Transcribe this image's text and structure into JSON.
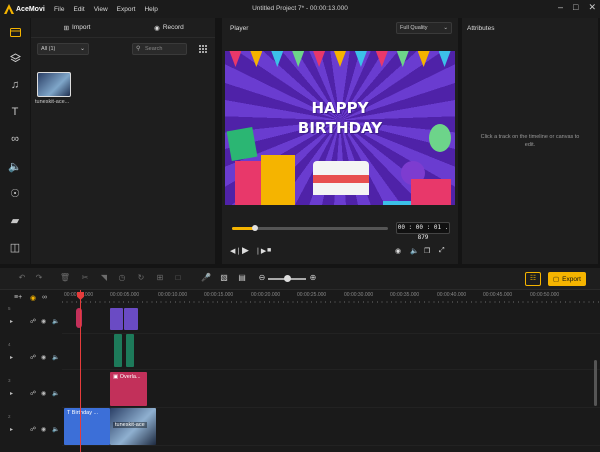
{
  "app": {
    "name": "AceMovi",
    "window_title": "Untitled Project 7* - 00:00:13.000",
    "menu": [
      "File",
      "Edit",
      "View",
      "Export",
      "Help"
    ]
  },
  "rail": [
    "media-folder",
    "layers",
    "music",
    "text",
    "effects",
    "transitions",
    "filters",
    "stickers",
    "split-screen"
  ],
  "media": {
    "import_label": "Import",
    "record_label": "Record",
    "filter_value": "All (1)",
    "search_placeholder": "Search",
    "items": [
      {
        "label": "tuneskit-ace..."
      }
    ]
  },
  "player": {
    "title": "Player",
    "quality": "Full Quality",
    "overlay_line1": "HAPPY",
    "overlay_line2": "BIRTHDAY",
    "timecode": "00 : 00 : 01 . 879",
    "progress": 0.15
  },
  "attributes": {
    "title": "Attributes",
    "hint": "Click a track on the timeline or canvas to edit."
  },
  "timeline": {
    "export_label": "Export",
    "ruler": [
      "00:00:00.000",
      "00:00:05.000",
      "00:00:10.000",
      "00:00:15.000",
      "00:00:20.000",
      "00:00:25.000",
      "00:00:30.000",
      "00:00:35.000",
      "00:00:40.000",
      "00:00:45.000",
      "00:00:50.000"
    ],
    "track_numbers": [
      "5",
      "4",
      "3",
      "2"
    ],
    "clips": {
      "overlay": "Overla...",
      "text": "Birthday ...",
      "video": "tuneskit-ace"
    }
  },
  "colors": {
    "accent": "#f5b400",
    "overlay_clip": "#c2305a",
    "text_clip": "#3c6fd8",
    "sticker_clip": "#6a4bc4",
    "audio_clip": "#1d7a5a",
    "playhead": "#e53c3c"
  }
}
